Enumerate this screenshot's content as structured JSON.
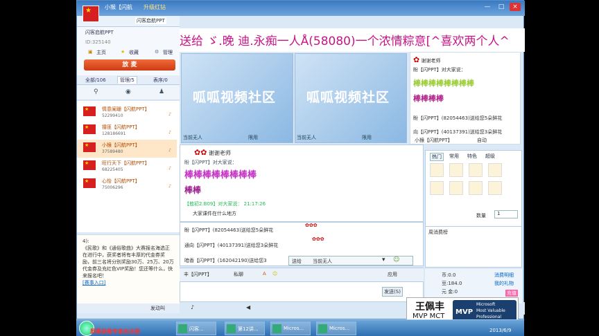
{
  "window": {
    "user_name": "小猴【闪航",
    "upgrade": "升级红钻",
    "room_name": "闪客启航PPT",
    "controls": [
      "—",
      "□",
      "×"
    ]
  },
  "roominfo": {
    "title": "闪客启航PPT",
    "id": "ID:325140",
    "home": "主页",
    "fav": "收藏",
    "manage": "管理",
    "mic_button": "放 麦"
  },
  "tabs": [
    {
      "label": "全部/106"
    },
    {
      "label": "管理/5"
    },
    {
      "label": "表序/0"
    }
  ],
  "users": [
    {
      "name": "情意阑珊【闪航PPT】",
      "id": "52299410"
    },
    {
      "name": "撞匪【闪航PPT】",
      "id": "128186691"
    },
    {
      "name": "小猴【闪航PPT】",
      "id": "37589480"
    },
    {
      "name": "旺行天下【闪航PPT】",
      "id": "68225405"
    },
    {
      "name": "心怡【闪航PPT】",
      "id": "75006296"
    }
  ],
  "notice": {
    "number": "4):",
    "text": "《民歌》和《通俗歌曲》大赛报名海选正在进行中，获奖者将有丰厚的代金券奖励，前三名将分别奖励30万、25万、20万代金券及充红色VIP奖励！您还等什么，快来报名吧！",
    "link": "[赛事入口]"
  },
  "leftbottom": {
    "audio": "发动叫"
  },
  "banner": "送给 ゞ.晚 迪.永痴一人Å(58080)一个浓情粽意[^喜欢两个人^",
  "videos": [
    {
      "watermark": "呱呱视频社区",
      "status": "当前无人",
      "limit": "限用"
    },
    {
      "watermark": "呱呱视频社区",
      "status": "当前无人",
      "limit": "限用"
    }
  ],
  "rchat": {
    "line1": "谢谢老师",
    "line2": "盼【闪PPT】对大家说：",
    "line3": "棒棒棒棒棒棒棒棒",
    "line4": "棒棒棒棒",
    "line5": "盼【闪PPT】(82054463)送给您5朵鲜花",
    "line6": "向【闪PPT】(40137391)送给您3朵鲜花",
    "line7": "小猴【闪航PPT】",
    "line8": "自动"
  },
  "pubchat": {
    "thanks": "谢谢老师",
    "sender": "盼【闪PPT】对大家说：",
    "bang_row1": "棒棒棒棒棒棒棒棒",
    "bang_row2": "棒棒",
    "time_line": "【敖初2.B09】对大家说：  21:17:26",
    "message": "大家课件在什么地方"
  },
  "privchat": {
    "l1": "盼【闪PPT】(82054463)送给您5朵鲜花",
    "l2": "通向【闪PPT】(40137391)送给您3朵鲜花",
    "l3": "暗香【闪PPT】(162042190)送给您3",
    "send_to": "送给",
    "target": "当前无人"
  },
  "fmtbar": {
    "target": "丰【闪PPT】",
    "private": "私聊",
    "app": "应用"
  },
  "send_button": "发送(S)",
  "gifts": {
    "tabs": [
      "热门",
      "常用",
      "特色",
      "超级"
    ],
    "qty_label": "数量",
    "qty_value": "1"
  },
  "weekrank": {
    "title": "周消费榜"
  },
  "wallet": {
    "coin": "币:0.0",
    "bean": "豆:184.0",
    "yuan": "元  金:0",
    "detail": "消费明细",
    "mygift": "我的礼物",
    "recharge": "充值"
  },
  "mvp": {
    "name": "王佩丰",
    "cert": "MVP  MCT",
    "logo1": "Microsoft",
    "logo2": "Most Valuable",
    "logo3": "Professional",
    "logo_mvp": "MVP"
  },
  "taskbar": {
    "items": [
      "闪客...",
      "第12讲...",
      "Micros...",
      "Micros..."
    ],
    "watermark": "屏幕录像专家未注册",
    "date": "2013/6/9"
  }
}
